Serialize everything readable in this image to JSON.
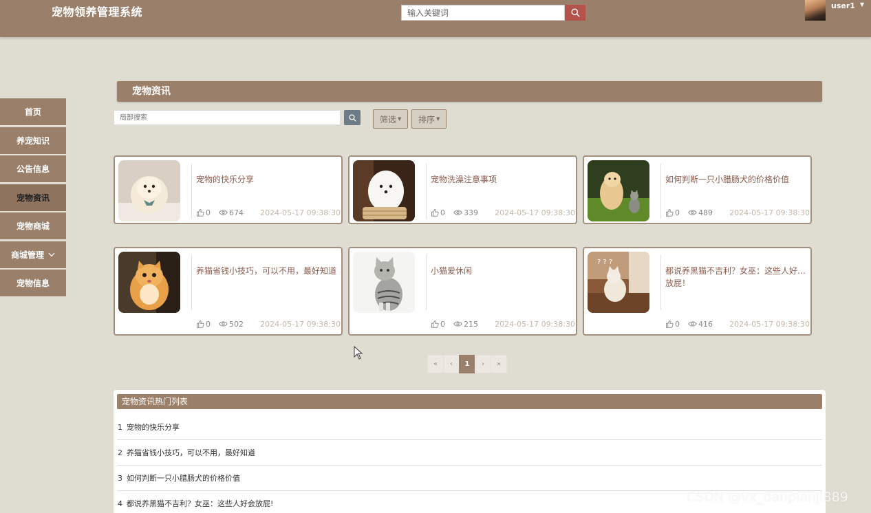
{
  "header": {
    "brand": "宠物领养管理系统",
    "search_placeholder": "输入关键词",
    "username": "user1"
  },
  "sidebar": {
    "items": [
      {
        "label": "首页"
      },
      {
        "label": "养宠知识"
      },
      {
        "label": "公告信息"
      },
      {
        "label": "宠物资讯",
        "active": true
      },
      {
        "label": "宠物商城"
      },
      {
        "label": "商城管理"
      },
      {
        "label": "宠物信息"
      }
    ]
  },
  "main": {
    "section_title": "宠物资讯",
    "local_search_placeholder": "局部搜索",
    "filter_label": "筛选",
    "sort_label": "排序",
    "cards": [
      {
        "title": "宠物的快乐分享",
        "likes": "0",
        "views": "674",
        "date": "2024-05-17 09:38:30",
        "image": "white-fluffy-puppy"
      },
      {
        "title": "宠物洗澡注意事项",
        "likes": "0",
        "views": "339",
        "date": "2024-05-17 09:38:30",
        "image": "maltese-puppy-in-basket"
      },
      {
        "title": "如何判断一只小腊肠犬的价格价值",
        "likes": "0",
        "views": "489",
        "date": "2024-05-17 09:38:30",
        "image": "puppy-and-kitten-on-grass"
      },
      {
        "title": "养猫省钱小技巧，可以不用，最好知道",
        "likes": "0",
        "views": "502",
        "date": "2024-05-17 09:38:30",
        "image": "orange-kitten"
      },
      {
        "title": "小猫爱休闲",
        "likes": "0",
        "views": "215",
        "date": "2024-05-17 09:38:30",
        "image": "silver-tabby-cat"
      },
      {
        "title": "都说养黑猫不吉利？女巫：这些人好…放屁！",
        "likes": "0",
        "views": "416",
        "date": "2024-05-17 09:38:30",
        "image": "confused-cat"
      }
    ],
    "pagination": {
      "first": "«",
      "prev": "‹",
      "current": "1",
      "next": "›",
      "last": "»"
    }
  },
  "hot_list": {
    "title": "宠物资讯热门列表",
    "items": [
      {
        "rank": "1",
        "title": "宠物的快乐分享"
      },
      {
        "rank": "2",
        "title": "养猫省钱小技巧，可以不用，最好知道"
      },
      {
        "rank": "3",
        "title": "如何判断一只小腊肠犬的价格价值"
      },
      {
        "rank": "4",
        "title": "都说养黑猫不吉利？女巫：这些人好会放屁!"
      }
    ]
  },
  "watermark": "CSDN @vx_danpianji889",
  "colors": {
    "primary": "#9a7f6a",
    "background": "#dfddd2",
    "search_button": "#b4534b",
    "card_title": "#8b5a4a"
  }
}
